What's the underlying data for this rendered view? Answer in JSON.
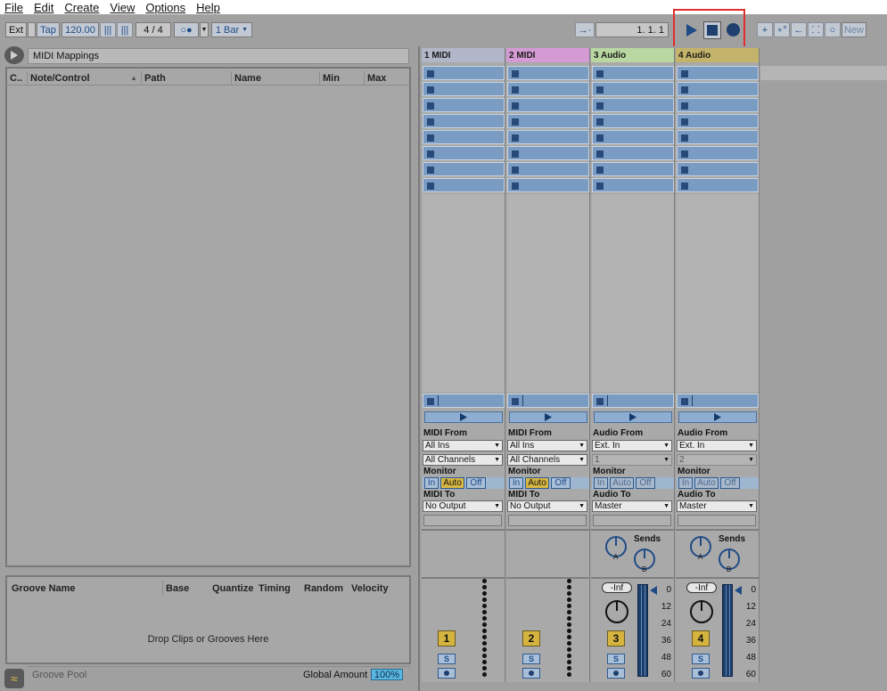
{
  "menu": [
    "File",
    "Edit",
    "Create",
    "View",
    "Options",
    "Help"
  ],
  "toolbar": {
    "ext": "Ext",
    "tap": "Tap",
    "tempo": "120.00",
    "signature": "4 / 4",
    "quantize": "1 Bar",
    "position": "1.   1.   1",
    "new": "New"
  },
  "mappings": {
    "title": "MIDI Mappings",
    "columns": [
      "C..",
      "Note/Control",
      "Path",
      "Name",
      "Min",
      "Max"
    ]
  },
  "groove": {
    "columns": [
      "Groove Name",
      "Base",
      "Quantize",
      "Timing",
      "Random",
      "Velocity"
    ],
    "placeholder": "Drop Clips or Grooves Here",
    "pool": "Groove Pool",
    "global_label": "Global Amount",
    "global_value": "100%"
  },
  "tracks": [
    {
      "name": "1 MIDI",
      "color": "#b1b6c8",
      "type": "midi",
      "from_label": "MIDI From",
      "from": "All Ins",
      "channel": "All Channels",
      "monitor": "Monitor",
      "to_label": "MIDI To",
      "to": "No Output",
      "number": "1",
      "solo": "S"
    },
    {
      "name": "2 MIDI",
      "color": "#d39ad4",
      "type": "midi",
      "from_label": "MIDI From",
      "from": "All Ins",
      "channel": "All Channels",
      "monitor": "Monitor",
      "to_label": "MIDI To",
      "to": "No Output",
      "number": "2",
      "solo": "S"
    },
    {
      "name": "3 Audio",
      "color": "#b9d8a1",
      "type": "audio",
      "from_label": "Audio From",
      "from": "Ext. In",
      "channel": "1",
      "monitor": "Monitor",
      "to_label": "Audio To",
      "to": "Master",
      "number": "3",
      "solo": "S",
      "sends": "Sends",
      "vol": "-Inf"
    },
    {
      "name": "4 Audio",
      "color": "#c4b36a",
      "type": "audio",
      "from_label": "Audio From",
      "from": "Ext. In",
      "channel": "2",
      "monitor": "Monitor",
      "to_label": "Audio To",
      "to": "Master",
      "number": "4",
      "solo": "S",
      "sends": "Sends",
      "vol": "-Inf"
    }
  ],
  "monitor_opts": [
    "In",
    "Auto",
    "Off"
  ],
  "send_labels": [
    "A",
    "B"
  ],
  "meter_scale": [
    "0",
    "12",
    "24",
    "36",
    "48",
    "60"
  ]
}
